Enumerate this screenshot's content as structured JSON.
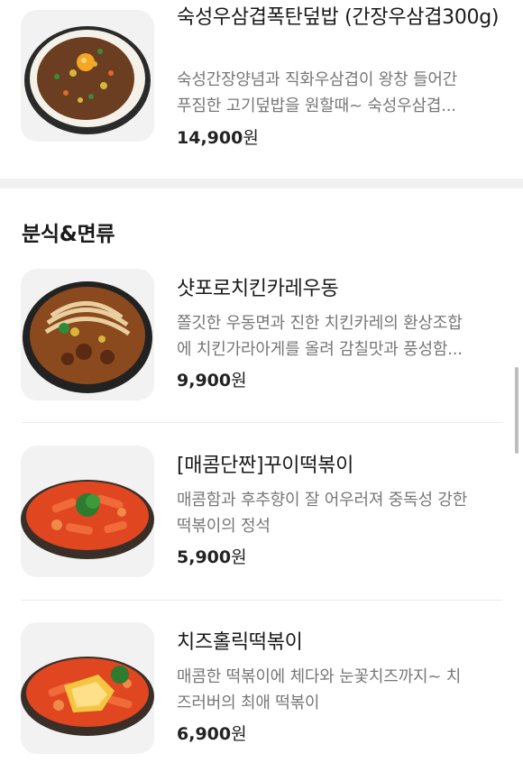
{
  "top_item": {
    "name": "숙성우삼겹폭탄덮밥 (간장우삼겹300g)",
    "description_line1": "숙성간장양념과 직화우삼겹이 왕창 들어간",
    "description_line2": "푸짐한 고기덮밥을 원할때~ 숙성우삼겹...",
    "price": "14,900",
    "currency": "원"
  },
  "section": {
    "title": "분식&면류",
    "items": [
      {
        "name": "샷포로치킨카레우동",
        "description_line1": "쫄깃한 우동면과 진한 치킨카레의 환상조합",
        "description_line2": "에 치킨가라아게를 올려 감칠맛과 풍성함...",
        "price": "9,900",
        "currency": "원"
      },
      {
        "name": "[매콤단짠]꾸이떡볶이",
        "description_line1": "매콤함과 후추향이 잘 어우러져 중독성 강한",
        "description_line2": "떡볶이의 정석",
        "price": "5,900",
        "currency": "원"
      },
      {
        "name": "치즈홀릭떡볶이",
        "description_line1": "매콤한 떡볶이에 체다와 눈꽃치즈까지~ 치",
        "description_line2": "즈러버의 최애 떡볶이",
        "price": "6,900",
        "currency": "원"
      }
    ]
  },
  "colors": {
    "text_primary": "#1a1a1a",
    "text_secondary": "#777777",
    "thumb_bg": "#f2f2f2",
    "divider": "#ececec"
  },
  "icons": {
    "food_images": [
      "beef-rice-bowl",
      "curry-udon-bowl",
      "tteokbokki-plate",
      "cheese-tteokbokki-plate"
    ]
  }
}
